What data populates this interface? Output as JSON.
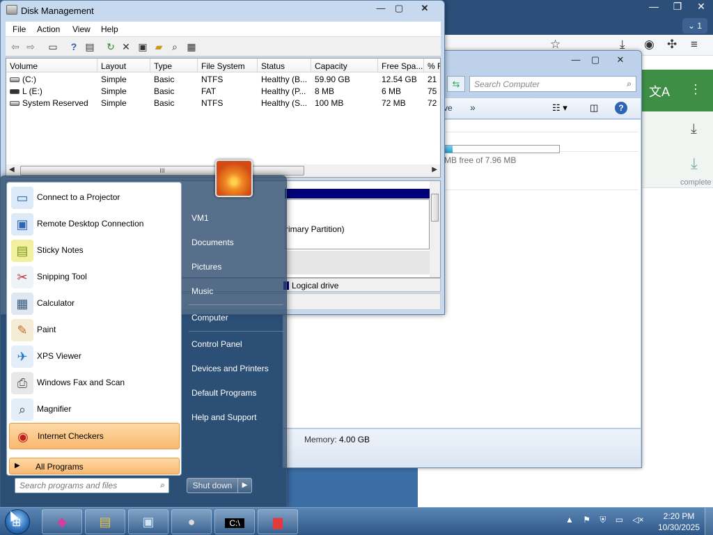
{
  "disk_management": {
    "title": "Disk Management",
    "menu": [
      "File",
      "Action",
      "View",
      "Help"
    ],
    "columns": [
      "Volume",
      "Layout",
      "Type",
      "File System",
      "Status",
      "Capacity",
      "Free Spa...",
      "% F"
    ],
    "rows": [
      {
        "volume": "(C:)",
        "layout": "Simple",
        "type": "Basic",
        "fs": "NTFS",
        "status": "Healthy (B...",
        "capacity": "59.90 GB",
        "free": "12.54 GB",
        "pct": "21"
      },
      {
        "volume": "L (E:)",
        "layout": "Simple",
        "type": "Basic",
        "fs": "FAT",
        "status": "Healthy (P...",
        "capacity": "8 MB",
        "free": "6 MB",
        "pct": "75"
      },
      {
        "volume": "System Reserved",
        "layout": "Simple",
        "type": "Basic",
        "fs": "NTFS",
        "status": "Healthy (S...",
        "capacity": "100 MB",
        "free": "72 MB",
        "pct": "72"
      }
    ],
    "partition_label": "rimary Partition)",
    "legend_logical": "Logical drive",
    "scroll_grip": "III"
  },
  "explorer": {
    "search_placeholder": "Search Computer",
    "cmd_partial": "ve",
    "cmd_more": "»",
    "free_text": "MB free of 7.96 MB",
    "drive_free_fraction": 0.08,
    "memory_label": "Memory:",
    "memory_value": "4.00 GB"
  },
  "browser": {
    "tab_count": "1",
    "download_text": "complete"
  },
  "start_menu": {
    "programs": [
      {
        "label": "Connect to a Projector",
        "icon": "projector-icon",
        "glyph": "▭"
      },
      {
        "label": "Remote Desktop Connection",
        "icon": "remote-desktop-icon",
        "glyph": "▣"
      },
      {
        "label": "Sticky Notes",
        "icon": "sticky-notes-icon",
        "glyph": "▤"
      },
      {
        "label": "Snipping Tool",
        "icon": "snipping-tool-icon",
        "glyph": "✂"
      },
      {
        "label": "Calculator",
        "icon": "calculator-icon",
        "glyph": "▦"
      },
      {
        "label": "Paint",
        "icon": "paint-icon",
        "glyph": "✎"
      },
      {
        "label": "XPS Viewer",
        "icon": "xps-viewer-icon",
        "glyph": "✈"
      },
      {
        "label": "Windows Fax and Scan",
        "icon": "fax-icon",
        "glyph": "⎙"
      },
      {
        "label": "Magnifier",
        "icon": "magnifier-icon",
        "glyph": "⌕"
      },
      {
        "label": "Internet Checkers",
        "icon": "checkers-icon",
        "glyph": "◉"
      }
    ],
    "all_programs": "All Programs",
    "search_placeholder": "Search programs and files",
    "right_items": [
      "VM1",
      "Documents",
      "Pictures",
      "Music",
      "Computer",
      "Control Panel",
      "Devices and Printers",
      "Default Programs",
      "Help and Support"
    ],
    "shutdown": "Shut down"
  },
  "taskbar": {
    "time": "2:20 PM",
    "date": "10/30/2025"
  },
  "colors": {
    "start_highlight": "#f9b870",
    "logical_drive": "#00007a"
  }
}
